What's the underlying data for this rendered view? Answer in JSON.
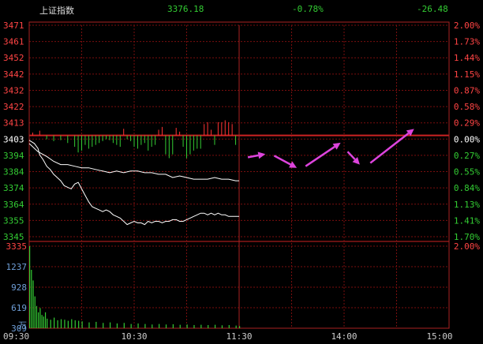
{
  "header": {
    "index_name": "上证指数",
    "last_price": "3376.18",
    "change_pct": "-0.78%",
    "change_pts": "-26.48"
  },
  "colors": {
    "background": "#000000",
    "grid": "#7a0e0e",
    "up": "#ff3333",
    "down": "#33cc33",
    "price_line": "#ffffff",
    "avg_line": "#ffffff",
    "arrow": "#dd44dd",
    "axis_text_left": "#ff4444",
    "axis_text_right_up": "#ff4444",
    "axis_text_right_down": "#33cc33",
    "volume_bar": "#33cc33"
  },
  "chart_data": {
    "type": "line",
    "base_price": 3403,
    "price_axis": {
      "labels": [
        "3471",
        "3461",
        "3452",
        "3442",
        "3432",
        "3422",
        "3413",
        "3403",
        "3394",
        "3384",
        "3374",
        "3364",
        "3355",
        "3345"
      ],
      "ylim": [
        3340.5,
        3471
      ]
    },
    "pct_axis": {
      "labels": [
        "2.00%",
        "1.73%",
        "1.44%",
        "1.15%",
        "0.87%",
        "0.58%",
        "0.29%",
        "0.00%",
        "0.27%",
        "0.55%",
        "0.84%",
        "1.13%",
        "1.41%",
        "1.70%"
      ]
    },
    "volume_axis": {
      "labels": [
        "3335",
        "1237",
        "928",
        "619",
        "309",
        "万"
      ],
      "right_label": "2.00%",
      "ylim": [
        0,
        1546
      ]
    },
    "time_axis": {
      "labels": [
        "09:30",
        "10:30",
        "11:30",
        "14:00",
        "15:00"
      ],
      "session_minutes": 240
    },
    "price_series": {
      "x": [
        0,
        3,
        5,
        6,
        8,
        10,
        12,
        14,
        16,
        18,
        20,
        22,
        24,
        26,
        28,
        30,
        32,
        34,
        36,
        38,
        40,
        42,
        44,
        46,
        48,
        50,
        52,
        54,
        56,
        58,
        60,
        62,
        64,
        66,
        68,
        70,
        72,
        74,
        76,
        78,
        80,
        82,
        84,
        86,
        88,
        90,
        92,
        94,
        96,
        98,
        100,
        102,
        104,
        106,
        108,
        110,
        112,
        114,
        116,
        118,
        120
      ],
      "values": [
        3400,
        3398,
        3395,
        3391,
        3388,
        3384,
        3382,
        3379,
        3377,
        3375,
        3372,
        3371,
        3370,
        3373,
        3374,
        3370,
        3366,
        3362,
        3359,
        3358,
        3357,
        3356,
        3357,
        3356,
        3354,
        3353,
        3352,
        3350,
        3348,
        3349,
        3350,
        3349,
        3349,
        3348,
        3350,
        3349,
        3350,
        3350,
        3349,
        3350,
        3350,
        3351,
        3351,
        3350,
        3350,
        3351,
        3352,
        3353,
        3354,
        3355,
        3355,
        3354,
        3355,
        3354,
        3355,
        3354,
        3354,
        3353,
        3353,
        3353,
        3353
      ]
    },
    "avg_series": {
      "x": [
        0,
        5,
        10,
        14,
        18,
        22,
        26,
        30,
        34,
        38,
        42,
        46,
        50,
        54,
        58,
        62,
        66,
        70,
        74,
        78,
        82,
        86,
        90,
        94,
        98,
        102,
        106,
        110,
        114,
        118,
        120
      ],
      "values": [
        3398,
        3393,
        3390,
        3387,
        3385,
        3385,
        3384,
        3383,
        3383,
        3382,
        3381,
        3380,
        3381,
        3380,
        3381,
        3381,
        3380,
        3380,
        3379,
        3379,
        3377,
        3378,
        3377,
        3376,
        3376,
        3376,
        3377,
        3376,
        3376,
        3375,
        3375
      ]
    },
    "breadth_bars": {
      "x": [
        2,
        6,
        10,
        14,
        18,
        22,
        26,
        28,
        30,
        32,
        34,
        36,
        38,
        40,
        42,
        44,
        46,
        48,
        50,
        52,
        54,
        56,
        58,
        60,
        62,
        64,
        66,
        68,
        70,
        72,
        74,
        76,
        78,
        80,
        82,
        84,
        86,
        88,
        90,
        92,
        94,
        96,
        98,
        100,
        102,
        104,
        106,
        108,
        110,
        112,
        114,
        116,
        118
      ],
      "values": [
        3,
        5,
        -4,
        -6,
        -5,
        -8,
        -12,
        -18,
        -16,
        -10,
        -14,
        -12,
        -10,
        -8,
        -6,
        -4,
        -5,
        -8,
        -10,
        -12,
        7,
        -4,
        -6,
        -12,
        -14,
        -10,
        -8,
        -16,
        -12,
        -10,
        6,
        9,
        -20,
        -24,
        -20,
        8,
        4,
        -12,
        -24,
        -20,
        -16,
        -14,
        -14,
        12,
        14,
        6,
        -10,
        14,
        14,
        16,
        14,
        12,
        -10
      ]
    },
    "volume_bars": {
      "x": [
        0,
        1,
        2,
        3,
        4,
        5,
        6,
        7,
        8,
        9,
        10,
        12,
        14,
        16,
        18,
        20,
        22,
        24,
        26,
        28,
        30,
        34,
        38,
        42,
        46,
        50,
        54,
        58,
        62,
        66,
        70,
        74,
        78,
        82,
        86,
        90,
        94,
        98,
        102,
        106,
        110,
        114,
        118,
        120
      ],
      "values": [
        1546,
        1100,
        900,
        600,
        420,
        300,
        380,
        250,
        220,
        300,
        180,
        160,
        200,
        150,
        170,
        160,
        140,
        170,
        150,
        140,
        130,
        110,
        120,
        100,
        110,
        90,
        100,
        80,
        90,
        80,
        70,
        80,
        70,
        75,
        65,
        70,
        60,
        65,
        60,
        65,
        55,
        60,
        50,
        40
      ]
    },
    "annotation_arrows": [
      {
        "from_x": 125,
        "from_y": 3389.5,
        "to_x": 135,
        "to_y": 3391.5
      },
      {
        "from_x": 140,
        "from_y": 3390.5,
        "to_x": 153,
        "to_y": 3383
      },
      {
        "from_x": 158,
        "from_y": 3384,
        "to_x": 178,
        "to_y": 3398.5
      },
      {
        "from_x": 182,
        "from_y": 3393,
        "to_x": 189,
        "to_y": 3385
      },
      {
        "from_x": 195,
        "from_y": 3386,
        "to_x": 220,
        "to_y": 3407
      }
    ]
  }
}
